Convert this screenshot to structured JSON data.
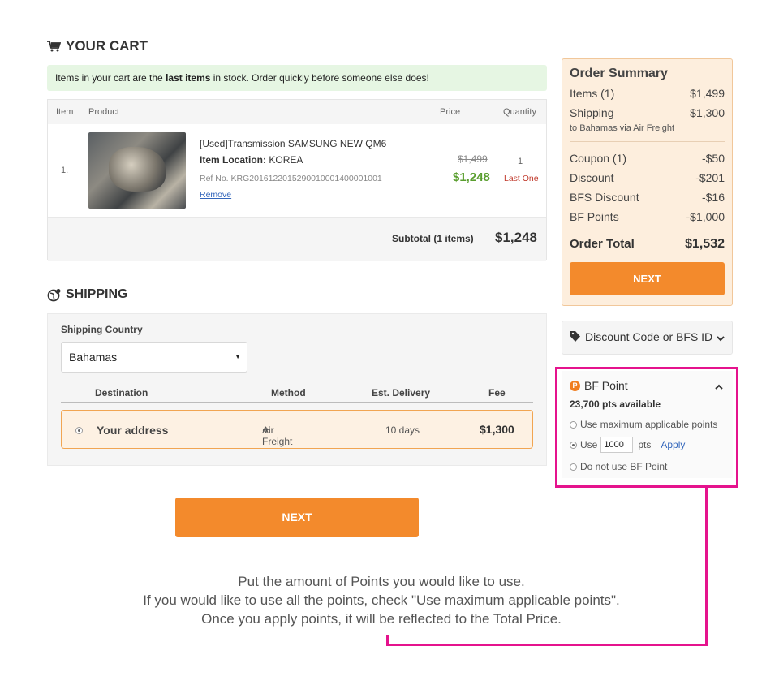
{
  "cart": {
    "title": "YOUR CART",
    "notice_pre": "Items in your cart are the ",
    "notice_bold": "last items",
    "notice_post": " in stock. Order quickly before someone else does!",
    "columns": {
      "item": "Item",
      "product": "Product",
      "price": "Price",
      "quantity": "Quantity"
    },
    "row": {
      "index": "1.",
      "name": "[Used]Transmission SAMSUNG NEW QM6",
      "location_label": "Item Location:",
      "location_value": "KOREA",
      "ref": "Ref No. KRG2016122015290010001400001001",
      "remove": "Remove",
      "old_price": "$1,499",
      "price": "$1,248",
      "qty": "1",
      "qty_note": "Last One"
    },
    "subtotal_label": "Subtotal (1 items)",
    "subtotal_value": "$1,248"
  },
  "shipping": {
    "title": "SHIPPING",
    "country_label": "Shipping Country",
    "country_value": "Bahamas",
    "columns": {
      "destination": "Destination",
      "method": "Method",
      "delivery": "Est. Delivery",
      "fee": "Fee"
    },
    "row": {
      "destination": "Your address",
      "method": "Air Freight",
      "delivery": "10 days",
      "fee": "$1,300"
    }
  },
  "next_label": "NEXT",
  "summary": {
    "title": "Order Summary",
    "items_label": "Items (1)",
    "items_value": "$1,499",
    "shipping_label": "Shipping",
    "shipping_value": "$1,300",
    "shipping_note": "to Bahamas via Air Freight",
    "coupon_label": "Coupon (1)",
    "coupon_value": "-$50",
    "discount_label": "Discount",
    "discount_value": "-$201",
    "bfs_label": "BFS Discount",
    "bfs_value": "-$16",
    "points_label": "BF Points",
    "points_value": "-$1,000",
    "total_label": "Order Total",
    "total_value": "$1,532",
    "next_label": "NEXT"
  },
  "discount_code": {
    "label": "Discount Code or BFS ID"
  },
  "bf_point": {
    "icon_letter": "P",
    "title": "BF Point",
    "available": "23,700 pts available",
    "opt_max": "Use maximum applicable points",
    "opt_use": "Use",
    "use_value": "1000",
    "pts_unit": "pts",
    "apply": "Apply",
    "opt_none": "Do not use BF Point"
  },
  "caption": {
    "line1": "Put the amount of Points you would like to use.",
    "line2": "If you would like to use all the points, check \"Use maximum applicable points\".",
    "line3": "Once you apply points, it will be reflected to the Total Price."
  },
  "colors": {
    "accent": "#f38a2c",
    "highlight": "#e5138d",
    "success": "#5a9e2f",
    "warning": "#c0392b"
  }
}
